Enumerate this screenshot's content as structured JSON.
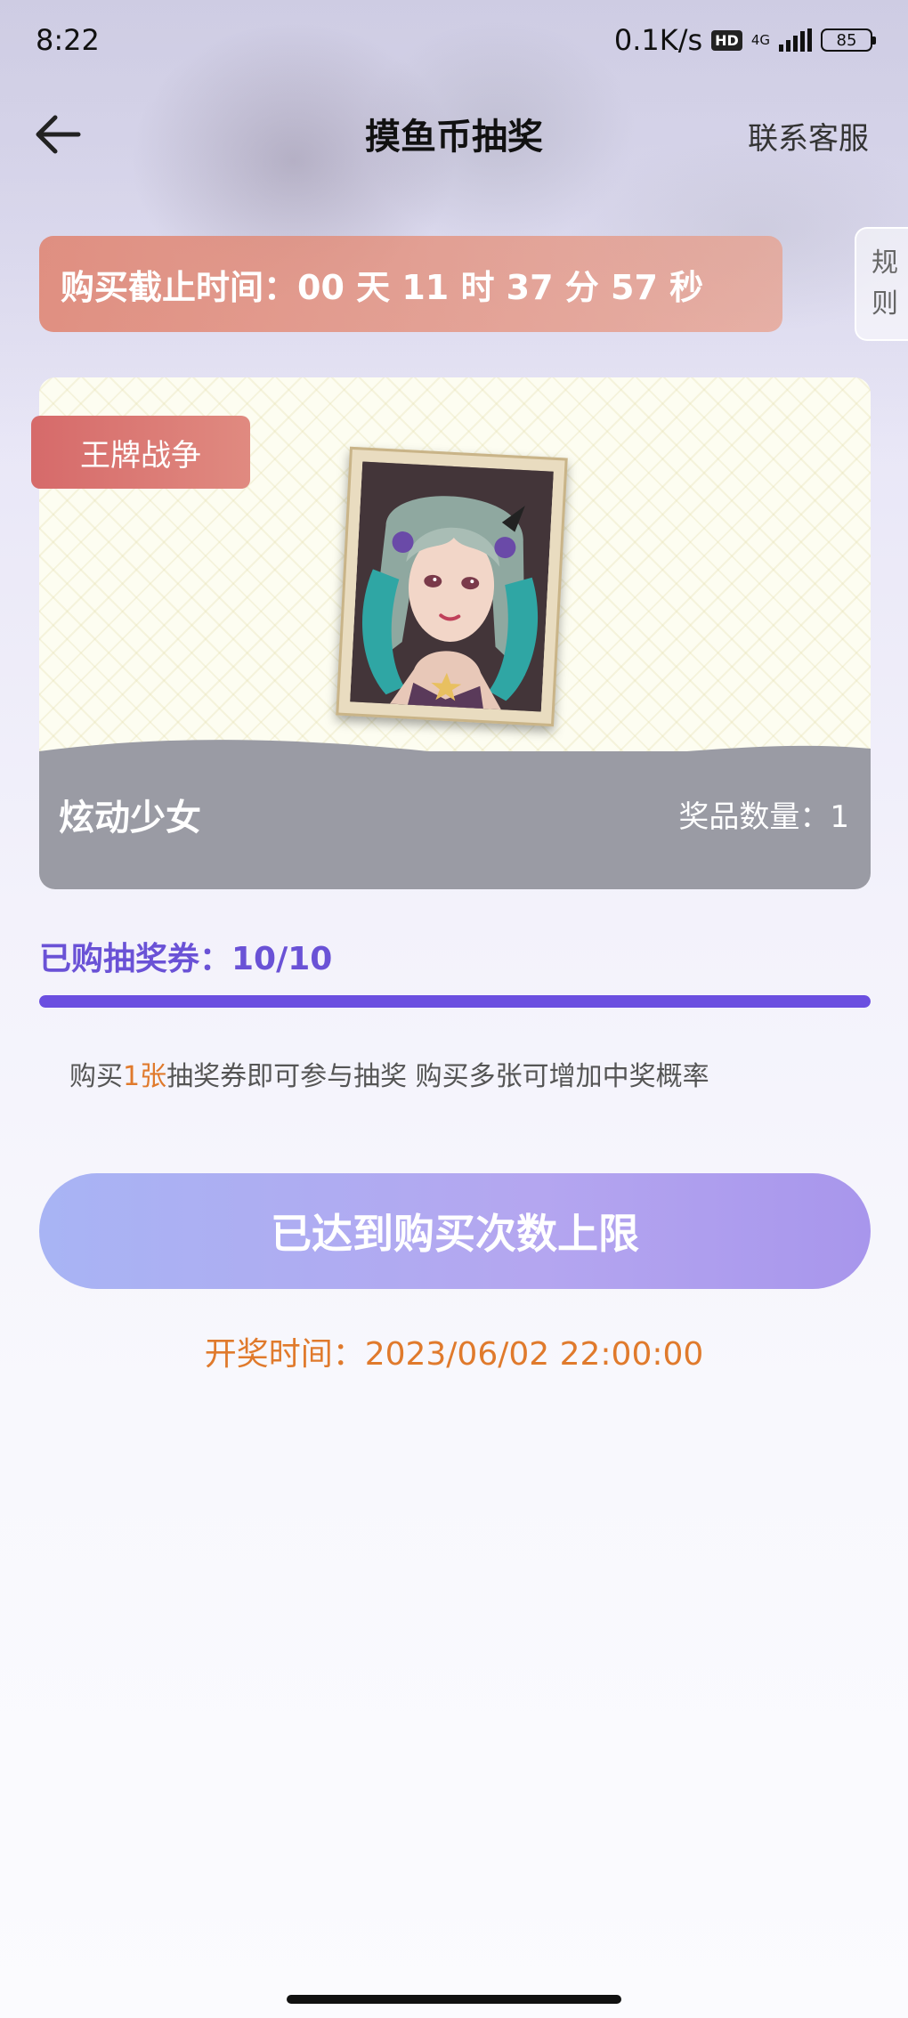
{
  "status_bar": {
    "time": "8:22",
    "net_speed": "0.1K/s",
    "hd": "HD",
    "network": "4G",
    "battery": "85"
  },
  "nav": {
    "title": "摸鱼币抽奖",
    "service": "联系客服",
    "back_icon": "arrow-left-icon"
  },
  "countdown": {
    "text": "购买截止时间：00 天 11 时 37 分 57 秒"
  },
  "rules_tab": {
    "line1": "规",
    "line2": "则"
  },
  "prize": {
    "game_tag": "王牌战争",
    "name": "炫动少女",
    "quantity_text": "奖品数量：1"
  },
  "purchase": {
    "label": "已购抽奖券：10/10",
    "progress_fraction": 1.0
  },
  "hint": {
    "prefix": "购买",
    "highlight": "1张",
    "suffix": "抽奖券即可参与抽奖 购买多张可增加中奖概率"
  },
  "action": {
    "button_label": "已达到购买次数上限"
  },
  "draw": {
    "time_text": "开奖时间：2023/06/02 22:00:00"
  },
  "colors": {
    "accent_purple": "#6b4fe0",
    "highlight_orange": "#e07a2c",
    "tag_red": "#d66a6a"
  }
}
